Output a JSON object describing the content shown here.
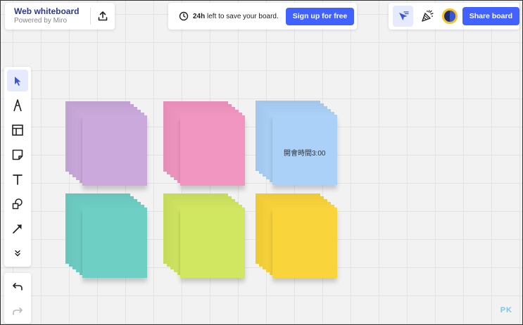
{
  "board": {
    "title": "Web whiteboard",
    "subtitle": "Powered by Miro",
    "export_icon": "upload-icon"
  },
  "notice": {
    "clock_icon": "clock-icon",
    "bold_text": "24h",
    "text": "left to save your board.",
    "signup_label": "Sign up for free"
  },
  "top_right": {
    "reactions_icon": "cursor-reactions-icon",
    "celebrate_icon": "party-popper-icon",
    "share_label": "Share board"
  },
  "toolbar": {
    "tools": [
      {
        "name": "select-tool",
        "icon": "cursor-icon",
        "active": true
      },
      {
        "name": "pen-tool",
        "icon": "pen-icon",
        "active": false
      },
      {
        "name": "templates-tool",
        "icon": "frame-icon",
        "active": false
      },
      {
        "name": "sticky-note-tool",
        "icon": "sticky-note-icon",
        "active": false
      },
      {
        "name": "text-tool",
        "icon": "text-icon",
        "active": false
      },
      {
        "name": "shapes-tool",
        "icon": "shapes-icon",
        "active": false
      },
      {
        "name": "connection-line-tool",
        "icon": "arrow-icon",
        "active": false
      },
      {
        "name": "more-tools",
        "icon": "chevron-double-down-icon",
        "active": false
      }
    ],
    "undo_icon": "undo-icon",
    "redo_icon": "redo-icon"
  },
  "stickies": {
    "colors": {
      "purple": "#c7a6d8",
      "pink": "#ec93bd",
      "blue": "#a8cdf3",
      "teal": "#6ccbc1",
      "green": "#cde15f",
      "yellow": "#f5d03a"
    },
    "note_text": "開會時間3:00"
  },
  "watermark": {
    "text": "PK"
  },
  "colors": {
    "accent": "#4262ff",
    "title": "#2b3a8c"
  }
}
